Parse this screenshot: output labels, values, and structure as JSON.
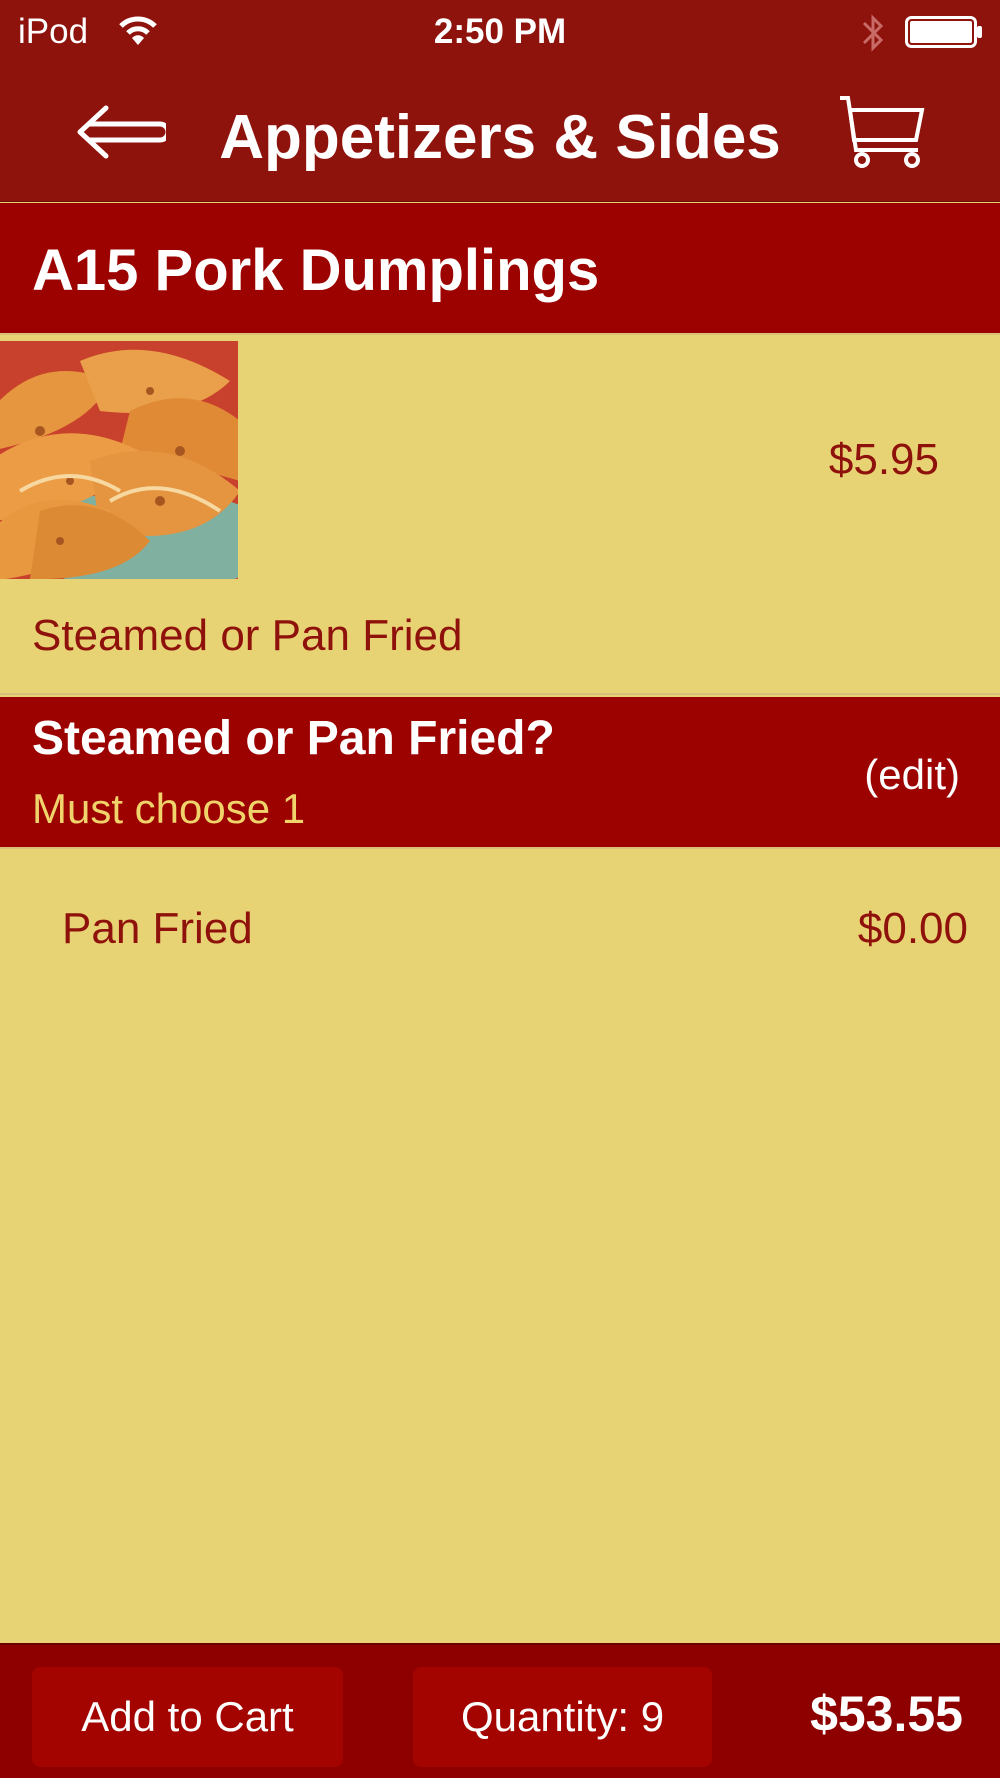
{
  "status_bar": {
    "carrier": "iPod",
    "time": "2:50 PM"
  },
  "navbar": {
    "title": "Appetizers & Sides",
    "back_icon": "back-arrow-icon",
    "cart_icon": "shopping-cart-icon"
  },
  "item": {
    "name": "A15 Pork Dumplings",
    "price": "$5.95",
    "description": "Steamed or Pan Fried"
  },
  "option": {
    "question": "Steamed or Pan Fried?",
    "requirement": "Must choose 1",
    "edit_label": "(edit)",
    "choices": [
      {
        "label": "Pan Fried",
        "price": "$0.00"
      }
    ]
  },
  "bottom_bar": {
    "add_to_cart_label": "Add to Cart",
    "quantity_label": "Quantity: 9",
    "total": "$53.55"
  },
  "colors": {
    "header_bar": "#8e130d",
    "section_header": "#9c0200",
    "background": "#e8d374",
    "text_dark_red": "#8e120b",
    "requirement_text": "#f0d36a"
  }
}
